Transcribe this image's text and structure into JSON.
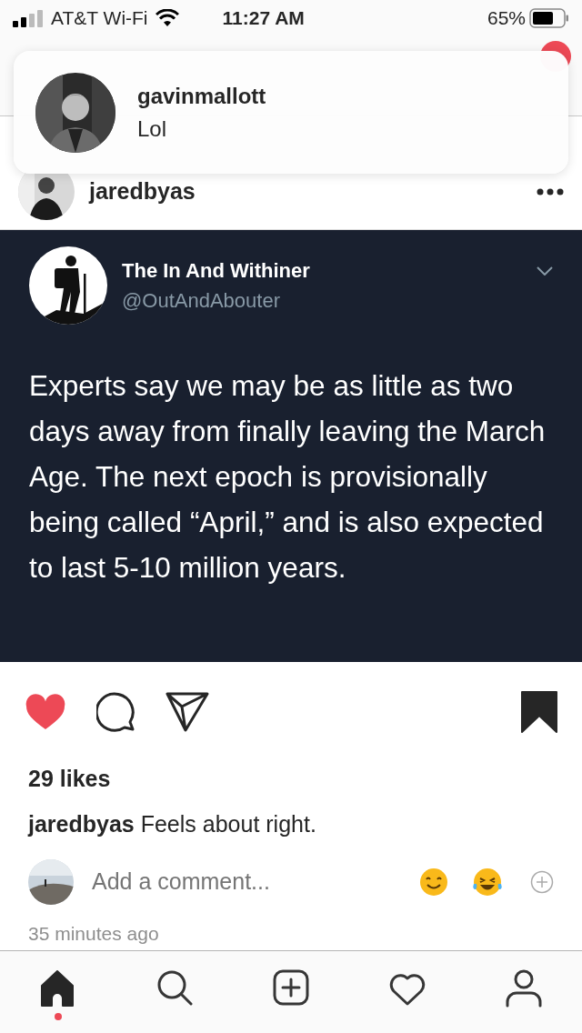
{
  "status_bar": {
    "carrier": "AT&T Wi-Fi",
    "time": "11:27 AM",
    "battery": "65%"
  },
  "notification": {
    "username": "gavinmallott",
    "message": "Lol"
  },
  "post": {
    "username": "jaredbyas",
    "tweet": {
      "name": "The In And Withiner",
      "handle": "@OutAndAbouter",
      "text": "Experts say we may be as little as two days away from finally leaving the March Age. The next epoch is provisionally being called “April,” and is also expected to last 5-10 million years."
    },
    "liked": true,
    "saved": true,
    "likes": "29 likes",
    "caption": {
      "username": "jaredbyas",
      "text": "Feels about right."
    },
    "comment": {
      "placeholder": "Add a comment..."
    },
    "time": "35 minutes ago"
  },
  "tab_bar": [
    {
      "kind": "home",
      "selected": true
    },
    {
      "kind": "search",
      "selected": false
    },
    {
      "kind": "add",
      "selected": false
    },
    {
      "kind": "activity",
      "selected": false
    },
    {
      "kind": "profile",
      "selected": false
    }
  ]
}
